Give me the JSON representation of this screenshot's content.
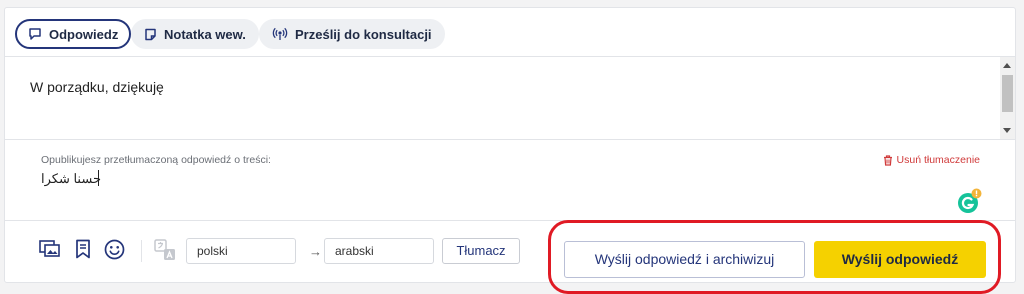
{
  "tabs": [
    {
      "label": "Odpowiedz",
      "icon": "chat-bubble-icon",
      "active": true
    },
    {
      "label": "Notatka wew.",
      "icon": "note-icon",
      "active": false
    },
    {
      "label": "Prześlij do konsultacji",
      "icon": "broadcast-icon",
      "active": false
    }
  ],
  "editor": {
    "text": "W porządku, dziękuję"
  },
  "translation": {
    "label": "Opublikujesz przetłumaczoną odpowiedź o treści:",
    "text": "حسنا شكرا",
    "remove_label": "Usuń tłumaczenie"
  },
  "toolbar": {
    "source_lang": "polski",
    "target_lang": "arabski",
    "arrow": "→",
    "translate_label": "Tłumacz"
  },
  "actions": {
    "archive_label": "Wyślij odpowiedź i archiwizuj",
    "send_label": "Wyślij odpowiedź"
  },
  "colors": {
    "accent": "#24357a",
    "send_button": "#f5d100",
    "highlight": "#e01a24",
    "danger": "#d03a3a"
  }
}
